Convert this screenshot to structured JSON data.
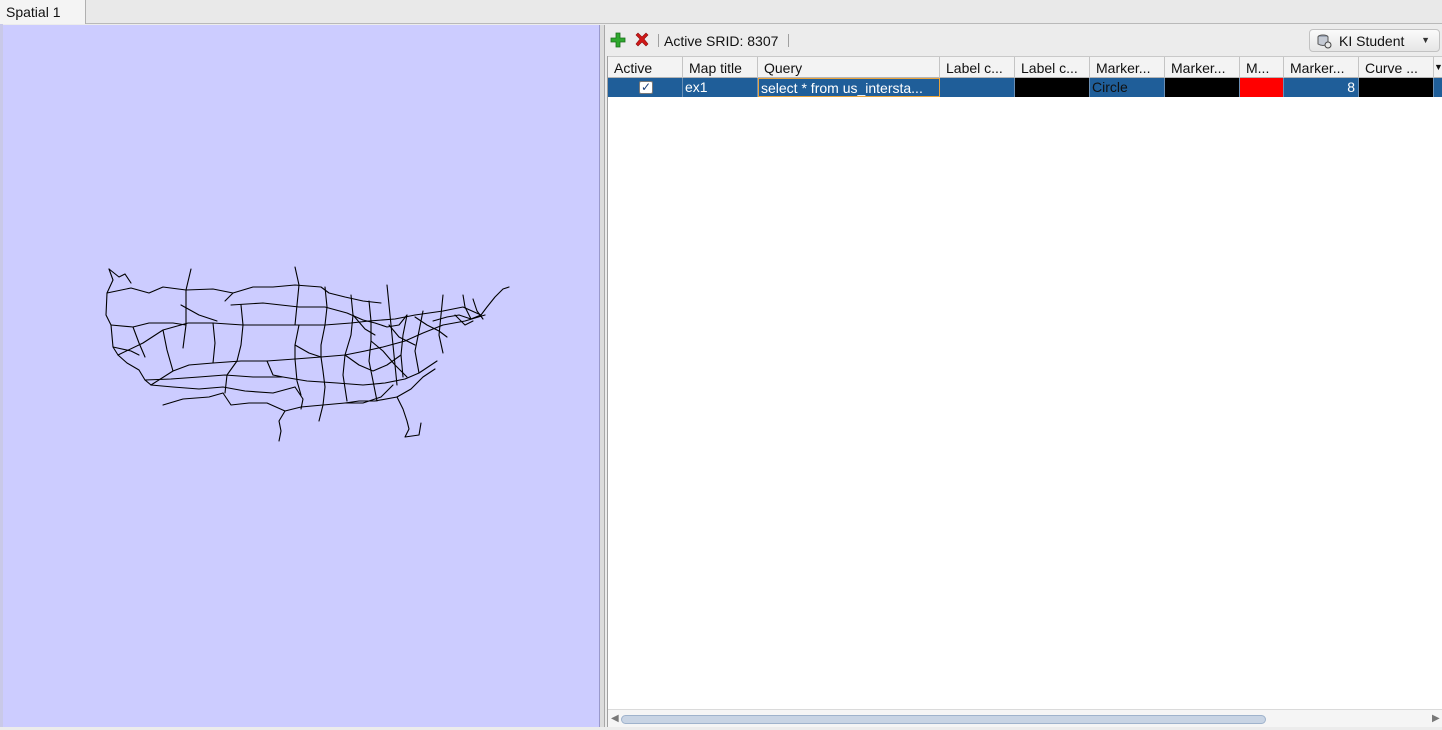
{
  "tab": {
    "label": "Spatial 1"
  },
  "toolbar": {
    "add_icon": "plus-icon",
    "remove_icon": "close-icon",
    "srid_text": "Active SRID: 8307",
    "connection_label": "KI Student",
    "connection_icon": "database-icon"
  },
  "table": {
    "headers": [
      "Active",
      "Map title",
      "Query",
      "Label c...",
      "Label c...",
      "Marker...",
      "Marker...",
      "M...",
      "Marker...",
      "Curve ..."
    ],
    "rows": [
      {
        "active": true,
        "map_title": "ex1",
        "query": "select * from us_intersta...",
        "label_color_1": "#1f5e99",
        "label_color_2": "#000000",
        "marker_shape": "Circle",
        "marker_color": "#000000",
        "m_color": "#ff0000",
        "marker_size": "8",
        "curve_color": "#000000"
      }
    ]
  },
  "map": {
    "background": "#ccccff",
    "layer_color": "#000000"
  },
  "colors": {
    "selection": "#1f5e99",
    "add_green": "#2ea82e",
    "remove_red": "#d01818"
  }
}
